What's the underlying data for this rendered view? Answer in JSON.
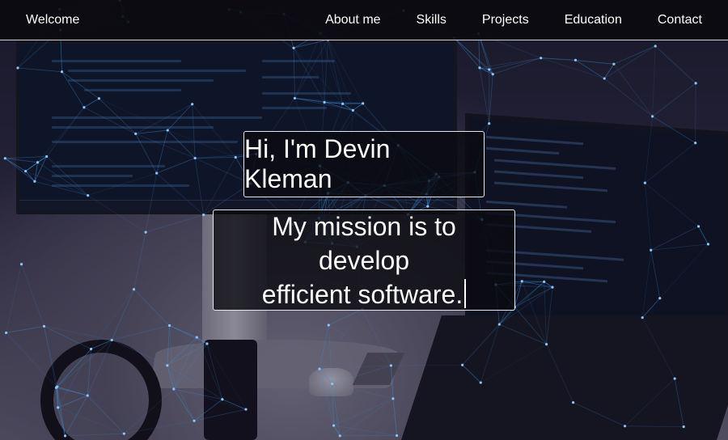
{
  "navbar": {
    "brand": "Welcome",
    "links": [
      "About me",
      "Skills",
      "Projects",
      "Education",
      "Contact"
    ]
  },
  "hero": {
    "greeting": "Hi, I'm Devin Kleman",
    "mission_line1": "My mission is to develop",
    "mission_line2": "efficient software."
  },
  "colors": {
    "navbar_bg": "#0a0a0e",
    "box_bg": "#0a0a10",
    "box_border": "#e6e6ea",
    "text": "#ffffff",
    "network_lines": "#3f8fd8"
  },
  "icons": {
    "cursor": "text-cursor-icon"
  }
}
